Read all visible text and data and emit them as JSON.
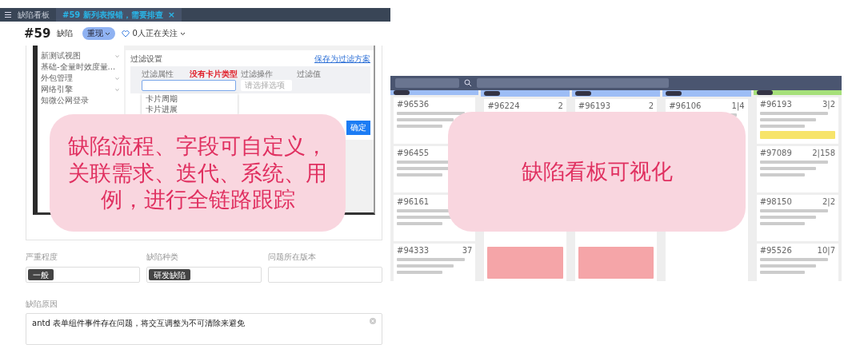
{
  "top_bar": {
    "tabs": [
      {
        "label": "缺陷看板",
        "selected": false
      },
      {
        "label": "#59 新列表报错，需要排查",
        "selected": true,
        "close": "×"
      }
    ]
  },
  "header": {
    "id": "#59",
    "type": "缺陷",
    "status": "重现",
    "watchers": "0人正在关注"
  },
  "embedded_screenshot": {
    "sidebar": [
      {
        "label": "新测试视图",
        "expandable": true
      },
      {
        "label": "基础-全量时效度量...",
        "expandable": false
      },
      {
        "label": "外包管理",
        "expandable": true
      },
      {
        "label": "网络引擎",
        "expandable": true
      },
      {
        "label": "知微公网登录",
        "expandable": false
      }
    ],
    "dialog": {
      "title": "过滤设置",
      "link": "保存为过滤方案",
      "columns": [
        "过滤属性",
        "过滤操作",
        "过滤值"
      ],
      "annotation": "没有卡片类型",
      "select_placeholder": "请选择选项",
      "options": [
        "卡片周期",
        "卡片进展"
      ],
      "confirm": "确定"
    }
  },
  "fields": [
    {
      "label": "严重程度",
      "tag": "一般"
    },
    {
      "label": "缺陷种类",
      "tag": "研发缺陷"
    },
    {
      "label": "问题所在版本"
    }
  ],
  "reason": {
    "label": "缺陷原因",
    "value": "antd 表单组件事件存在问题，将交互调整为不可清除来避免"
  },
  "kanban": {
    "columns": [
      {
        "color": "#9dbdf5",
        "cards": [
          {
            "id": "#96536"
          },
          {
            "id": "#96455"
          },
          {
            "id": "#96161"
          },
          {
            "id": "#94333",
            "count": "37"
          }
        ]
      },
      {
        "color": "#9dbdf5",
        "cards": [
          {
            "id": "#96224",
            "count": "2",
            "color": "#f5a5a8"
          }
        ]
      },
      {
        "color": "#9dbdf5",
        "cards": [
          {
            "id": "#96193",
            "count": "2",
            "color": "#f5a5a8"
          }
        ]
      },
      {
        "color": "#9dbdf5",
        "cards": [
          {
            "id": "#96106",
            "count": "1|4"
          }
        ]
      },
      {
        "color": "#a6e07a",
        "cards": [
          {
            "id": "#96193",
            "count": "3|2",
            "color": "#f7e46a"
          },
          {
            "id": "#97089",
            "count": "2|158"
          },
          {
            "id": "#98150",
            "count": "2|2"
          },
          {
            "id": "#95526",
            "count": "10|7"
          }
        ]
      }
    ]
  },
  "callouts": [
    {
      "text": "缺陷流程、字段可自定义，关联需求、迭代、系统、用例，进行全链路跟踪"
    },
    {
      "text": "缺陷看板可视化"
    }
  ]
}
